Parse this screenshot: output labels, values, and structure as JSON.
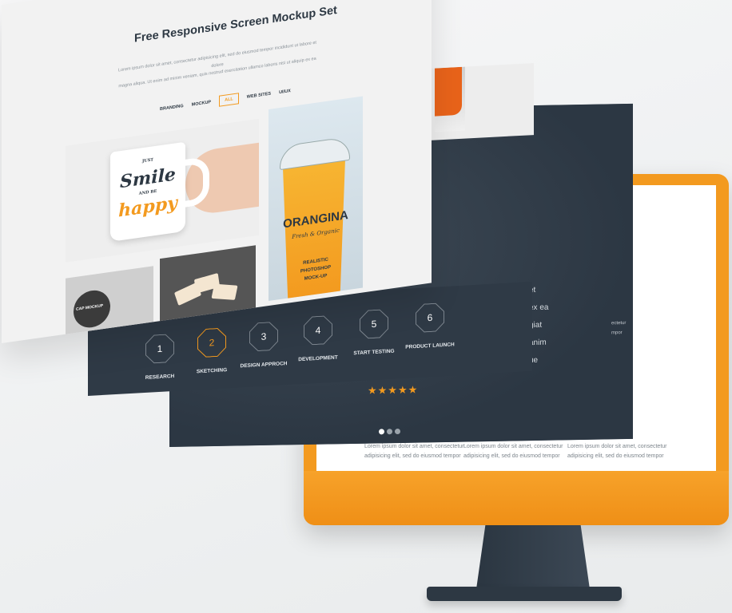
{
  "front": {
    "title": "Free Responsive Screen Mockup Set",
    "lorem1": "Lorem ipsum dolor sit amet, consectetur adipisicing elit, sed do eiusmod tempor incididunt ut labore et dolore",
    "lorem2": "magna aliqua. Ut enim ad minim veniam, quis nostrud exercitation ullamco laboris nisi ut aliquip ex ea",
    "filters": [
      "BRANDING",
      "MOCKUP",
      "ALL",
      "WEB SITES",
      "UI/UX"
    ],
    "active_filter": "ALL",
    "mug": {
      "top": "JUST",
      "word1": "Smile",
      "mid": "AND BE",
      "word2": "happy"
    },
    "cap_label": "CAP MOCKUP",
    "drink": {
      "brand": "ORANGINA",
      "tagline": "Fresh & Organic",
      "line1": "REALISTIC",
      "line2": "PHOTOSHOP",
      "line3": "MOCK-UP"
    }
  },
  "steps": [
    {
      "num": "1",
      "label": "RESEARCH"
    },
    {
      "num": "2",
      "label": "SKETCHING"
    },
    {
      "num": "3",
      "label": "DESIGN APPROCH"
    },
    {
      "num": "4",
      "label": "DEVELOPMENT"
    },
    {
      "num": "5",
      "label": "START TESTING"
    },
    {
      "num": "6",
      "label": "PRODUCT LAUNCH"
    }
  ],
  "active_step": 2,
  "hero": {
    "lines": [
      "et",
      "ex ea",
      "giat",
      "anim",
      "ue"
    ],
    "small": [
      "ectetur",
      "mpor"
    ],
    "stars": "★★★★★",
    "rating": 5
  },
  "imac": {
    "col1": [
      "Lorem ipsum dolor sit amet, consectetur",
      "adipisicing elit, sed do eiusmod tempor"
    ],
    "col2": [
      "Lorem ipsum dolor sit amet, consectetur",
      "adipisicing elit, sed do eiusmod tempor"
    ],
    "col3": [
      "Lorem ipsum dolor sit amet, consectetur",
      "adipisicing elit, sed do eiusmod tempor"
    ]
  },
  "colors": {
    "accent": "#f39a1f",
    "dark": "#2f3a46",
    "text": "#2d3843"
  }
}
